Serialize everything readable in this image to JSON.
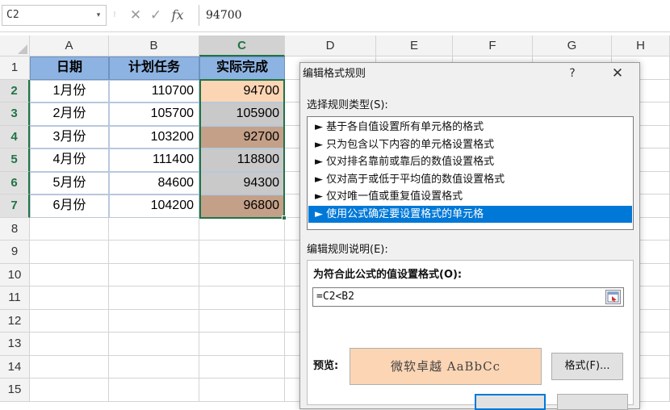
{
  "formula_bar": {
    "name_box": "C2",
    "name_box_arrow": "▾",
    "separator": "⁝",
    "cancel_glyph": "✕",
    "enter_glyph": "✓",
    "fx_label": "fx",
    "formula": "94700"
  },
  "columns": [
    "A",
    "B",
    "C",
    "D",
    "E",
    "F",
    "G",
    "H"
  ],
  "rows": [
    "1",
    "2",
    "3",
    "4",
    "5",
    "6",
    "7",
    "8",
    "9",
    "10",
    "11",
    "12",
    "13",
    "14",
    "15"
  ],
  "table": {
    "headers": [
      "日期",
      "计划任务",
      "实际完成"
    ],
    "rows": [
      {
        "month": "1月份",
        "plan": "110700",
        "actual": "94700",
        "fill": "#fcd5b4"
      },
      {
        "month": "2月份",
        "plan": "105700",
        "actual": "105900",
        "fill": "#c9c9c9"
      },
      {
        "month": "3月份",
        "plan": "103200",
        "actual": "92700",
        "fill": "#c4a088"
      },
      {
        "month": "4月份",
        "plan": "111400",
        "actual": "118800",
        "fill": "#c9c9c9"
      },
      {
        "month": "5月份",
        "plan": "84600",
        "actual": "94300",
        "fill": "#c9c9c9"
      },
      {
        "month": "6月份",
        "plan": "104200",
        "actual": "96800",
        "fill": "#c4a088"
      }
    ]
  },
  "colors": {
    "header_fill": "#8db3e2",
    "selection": "#217346",
    "list_highlight": "#0078d7",
    "preview_fill": "#fcd5b4"
  },
  "dialog": {
    "title": "编辑格式规则",
    "help": "?",
    "close": "✕",
    "rule_type_label": "选择规则类型(S):",
    "rule_types": [
      "► 基于各自值设置所有单元格的格式",
      "► 只为包含以下内容的单元格设置格式",
      "► 仅对排名靠前或靠后的数值设置格式",
      "► 仅对高于或低于平均值的数值设置格式",
      "► 仅对唯一值或重复值设置格式",
      "► 使用公式确定要设置格式的单元格"
    ],
    "selected_rule_index": 5,
    "description_label": "编辑规则说明(E):",
    "formula_caption": "为符合此公式的值设置格式(O):",
    "formula_value": "=C2<B2",
    "preview_label": "预览:",
    "preview_text": "微软卓越  AaBbCc",
    "format_button": "格式(F)..."
  }
}
